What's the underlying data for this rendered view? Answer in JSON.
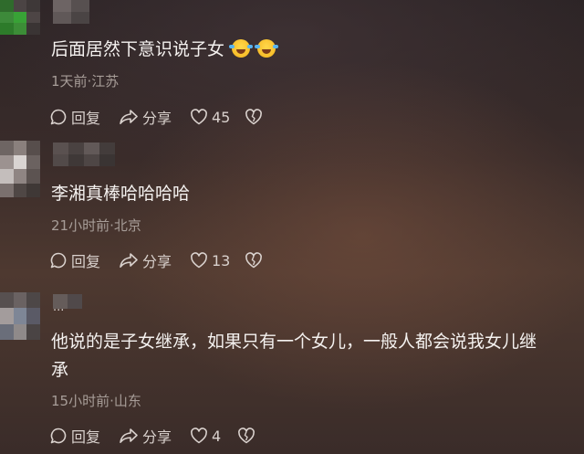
{
  "comments": [
    {
      "avatar": "pixelated-avatar",
      "username": "",
      "text": "后面居然下意识说子女",
      "emojis": [
        "rolling-on-floor-laughing-emoji",
        "rolling-on-floor-laughing-emoji"
      ],
      "meta": "1天前·江苏",
      "reply_label": "回复",
      "share_label": "分享",
      "likes": "45"
    },
    {
      "avatar": "pixelated-avatar",
      "username": "",
      "text": "李湘真棒哈哈哈哈",
      "emojis": [],
      "meta": "21小时前·北京",
      "reply_label": "回复",
      "share_label": "分享",
      "likes": "13"
    },
    {
      "avatar": "pixelated-avatar",
      "username": "...",
      "text_line1": "他说的是子女继承，如果只有一个女儿，一般人都会说我女儿继",
      "text_line2": "承",
      "emojis": [],
      "meta": "15小时前·山东",
      "reply_label": "回复",
      "share_label": "分享",
      "likes": "4"
    }
  ],
  "icons": {
    "reply": "comment-bubble-icon",
    "share": "share-arrow-icon",
    "like": "heart-icon",
    "dislike": "broken-heart-icon"
  },
  "colors": {
    "text": "#f4f1ef",
    "meta": "#a79d98",
    "action": "#d9d1cd",
    "mosaic_green": "#3d8a3a"
  }
}
